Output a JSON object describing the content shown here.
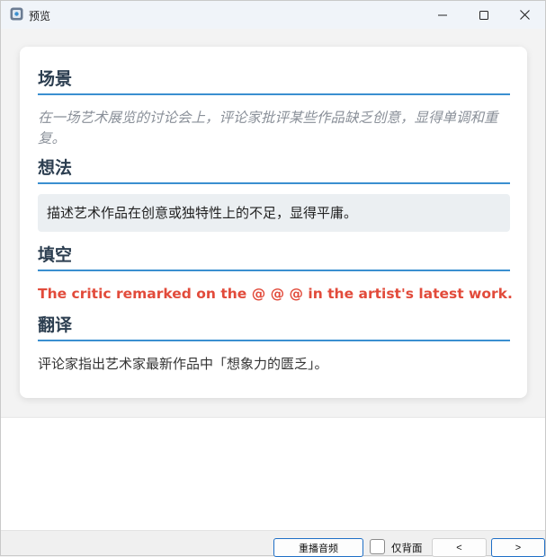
{
  "window": {
    "title": "预览"
  },
  "card": {
    "scene": {
      "heading": "场景",
      "text": "在一场艺术展览的讨论会上，评论家批评某些作品缺乏创意，显得单调和重复。"
    },
    "idea": {
      "heading": "想法",
      "text": "描述艺术作品在创意或独特性上的不足，显得平庸。"
    },
    "cloze": {
      "heading": "填空",
      "text": "The critic remarked on the @ @ @ in the artist's latest work."
    },
    "translation": {
      "heading": "翻译",
      "text": "评论家指出艺术家最新作品中「想象力的匮乏」。"
    }
  },
  "toolbar": {
    "replay_label": "重播音频",
    "back_only_label": "仅背面",
    "back_only_checked": false,
    "prev_label": "<",
    "next_label": ">"
  },
  "colors": {
    "heading": "#2c3e50",
    "heading_underline": "#3a8fd0",
    "scene_text": "#8a9099",
    "cloze_text": "#e24b3b",
    "idea_box_bg": "#ebeff2",
    "focus_border": "#1f6fc6"
  },
  "icons": {
    "app": "app-icon",
    "minimize": "minimize-icon",
    "maximize": "maximize-icon",
    "close": "close-icon"
  }
}
